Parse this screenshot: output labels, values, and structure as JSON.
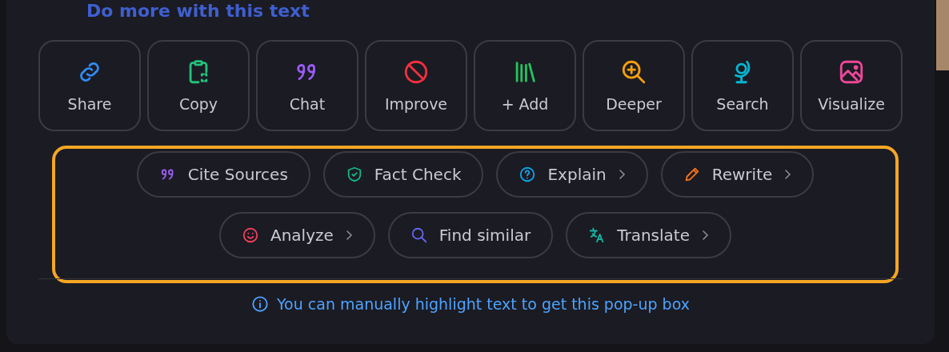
{
  "heading": "Do more with this text",
  "actions": [
    {
      "label": "Share",
      "kind": "link"
    },
    {
      "label": "Copy",
      "kind": "clipboard"
    },
    {
      "label": "Chat",
      "kind": "quote"
    },
    {
      "label": "Improve",
      "kind": "ban"
    },
    {
      "label": "+ Add",
      "kind": "books"
    },
    {
      "label": "Deeper",
      "kind": "zoom"
    },
    {
      "label": "Search",
      "kind": "globe"
    },
    {
      "label": "Visualize",
      "kind": "image"
    }
  ],
  "chip_rows": [
    [
      {
        "label": "Cite Sources",
        "kind": "cite",
        "has_submenu": false
      },
      {
        "label": "Fact Check",
        "kind": "shield",
        "has_submenu": false
      },
      {
        "label": "Explain",
        "kind": "help",
        "has_submenu": true
      },
      {
        "label": "Rewrite",
        "kind": "pencil",
        "has_submenu": true
      }
    ],
    [
      {
        "label": "Analyze",
        "kind": "smile",
        "has_submenu": true
      },
      {
        "label": "Find similar",
        "kind": "search",
        "has_submenu": false
      },
      {
        "label": "Translate",
        "kind": "translate",
        "has_submenu": true
      }
    ]
  ],
  "hint": "You can manually highlight text to get this pop-up box"
}
